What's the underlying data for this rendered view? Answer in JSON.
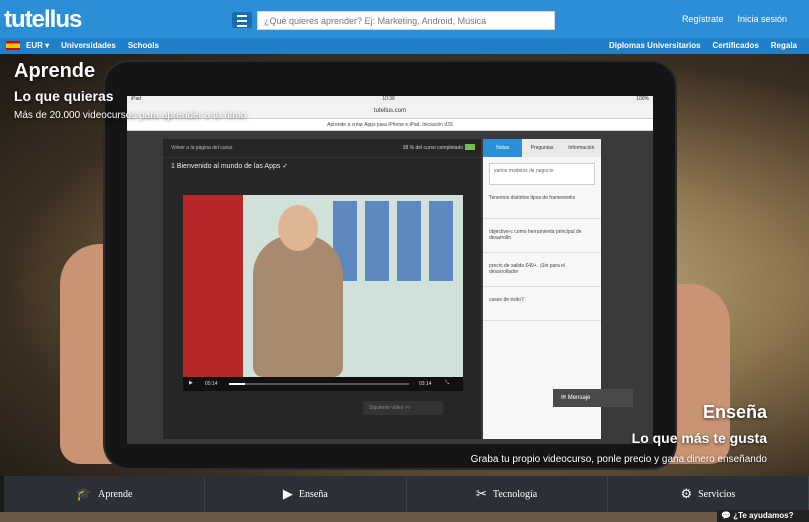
{
  "header": {
    "logo": "tutellus",
    "search_placeholder": "¿Qué quieres aprender? Ej: Marketing, Android, Música",
    "register": "Regístrate",
    "login": "Inicia sesión"
  },
  "subbar": {
    "currency": "EUR ▾",
    "left_links": [
      "Universidades",
      "Schools"
    ],
    "right_links": [
      "Diplomas Universitarios",
      "Certificados",
      "Regala"
    ]
  },
  "hero": {
    "title": "Aprende",
    "subtitle": "Lo que quieras",
    "tagline": "Más de 20.000 videocursos para aprender a tu ritmo",
    "teach_title": "Enseña",
    "teach_subtitle": "Lo que más te gusta",
    "teach_tagline": "Graba tu propio videocurso, ponle precio y gana dinero enseñando"
  },
  "tablet": {
    "status_left": "iPad",
    "status_time": "10:36",
    "status_right": "100%",
    "url": "tutellus.com",
    "course_title": "Aprende a crear Apps para iPhone e iPad. Iniciación iOS",
    "back_text": "Volver a la página del curso",
    "progress_text": "38 % del curso completado",
    "lesson": "1    Bienvenido al mundo de las Apps  ✓",
    "time_current": "00:14",
    "time_total": "03:14",
    "next_button": "Siguiente vídeo  >>",
    "tabs": [
      "Notas",
      "Preguntas",
      "Información"
    ],
    "note_placeholder": "varios modelos de negocio",
    "side_items": [
      "Tenemos distintos tipos de frameworks",
      "objective-c como herramienta principal de desarrollo",
      "precio de salida €49+. ¡Sin para el desarrollador",
      "cases de éxito?"
    ],
    "message_button": "Mensaje"
  },
  "bottom_nav": [
    {
      "icon": "graduation-cap-icon",
      "glyph": "🎓",
      "label": "Aprende"
    },
    {
      "icon": "video-icon",
      "glyph": "▶",
      "label": "Enseña"
    },
    {
      "icon": "tools-icon",
      "glyph": "✂",
      "label": "Tecnología"
    },
    {
      "icon": "lifebuoy-icon",
      "glyph": "⚙",
      "label": "Servicios"
    }
  ],
  "help_text": "¿Te ayudamos?",
  "colors": {
    "brand": "#2a8fd6",
    "nav": "#2b3036",
    "progress": "#6cc24a"
  }
}
